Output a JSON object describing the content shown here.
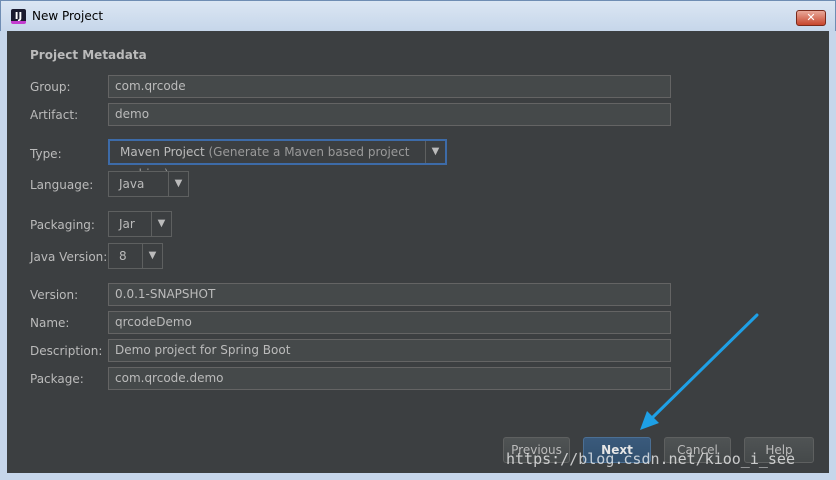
{
  "window": {
    "title": "New Project",
    "close_glyph": "✕"
  },
  "section_title": "Project Metadata",
  "fields": {
    "group": {
      "label": "Group:",
      "value": "com.qrcode"
    },
    "artifact": {
      "label": "Artifact:",
      "value": "demo"
    },
    "type": {
      "label": "Type:",
      "value": "Maven Project",
      "hint": " (Generate a Maven based project archive)"
    },
    "language": {
      "label": "Language:",
      "value": "Java"
    },
    "packaging": {
      "label": "Packaging:",
      "value": "Jar"
    },
    "java_version": {
      "label": "Java Version:",
      "value": "8"
    },
    "version": {
      "label": "Version:",
      "value": "0.0.1-SNAPSHOT"
    },
    "name": {
      "label": "Name:",
      "value": "qrcodeDemo"
    },
    "description": {
      "label": "Description:",
      "value": "Demo project for Spring Boot"
    },
    "package": {
      "label": "Package:",
      "value": "com.qrcode.demo"
    }
  },
  "buttons": {
    "previous": "Previous",
    "next": "Next",
    "cancel": "Cancel",
    "help": "Help"
  },
  "watermark": "https://blog.csdn.net/kioo_i_see",
  "icons": {
    "dropdown": "chevron-down-icon",
    "app": "intellij-icon"
  },
  "colors": {
    "background": "#3c3f41",
    "accent": "#3d6ba8",
    "arrow": "#1ea0e6"
  }
}
